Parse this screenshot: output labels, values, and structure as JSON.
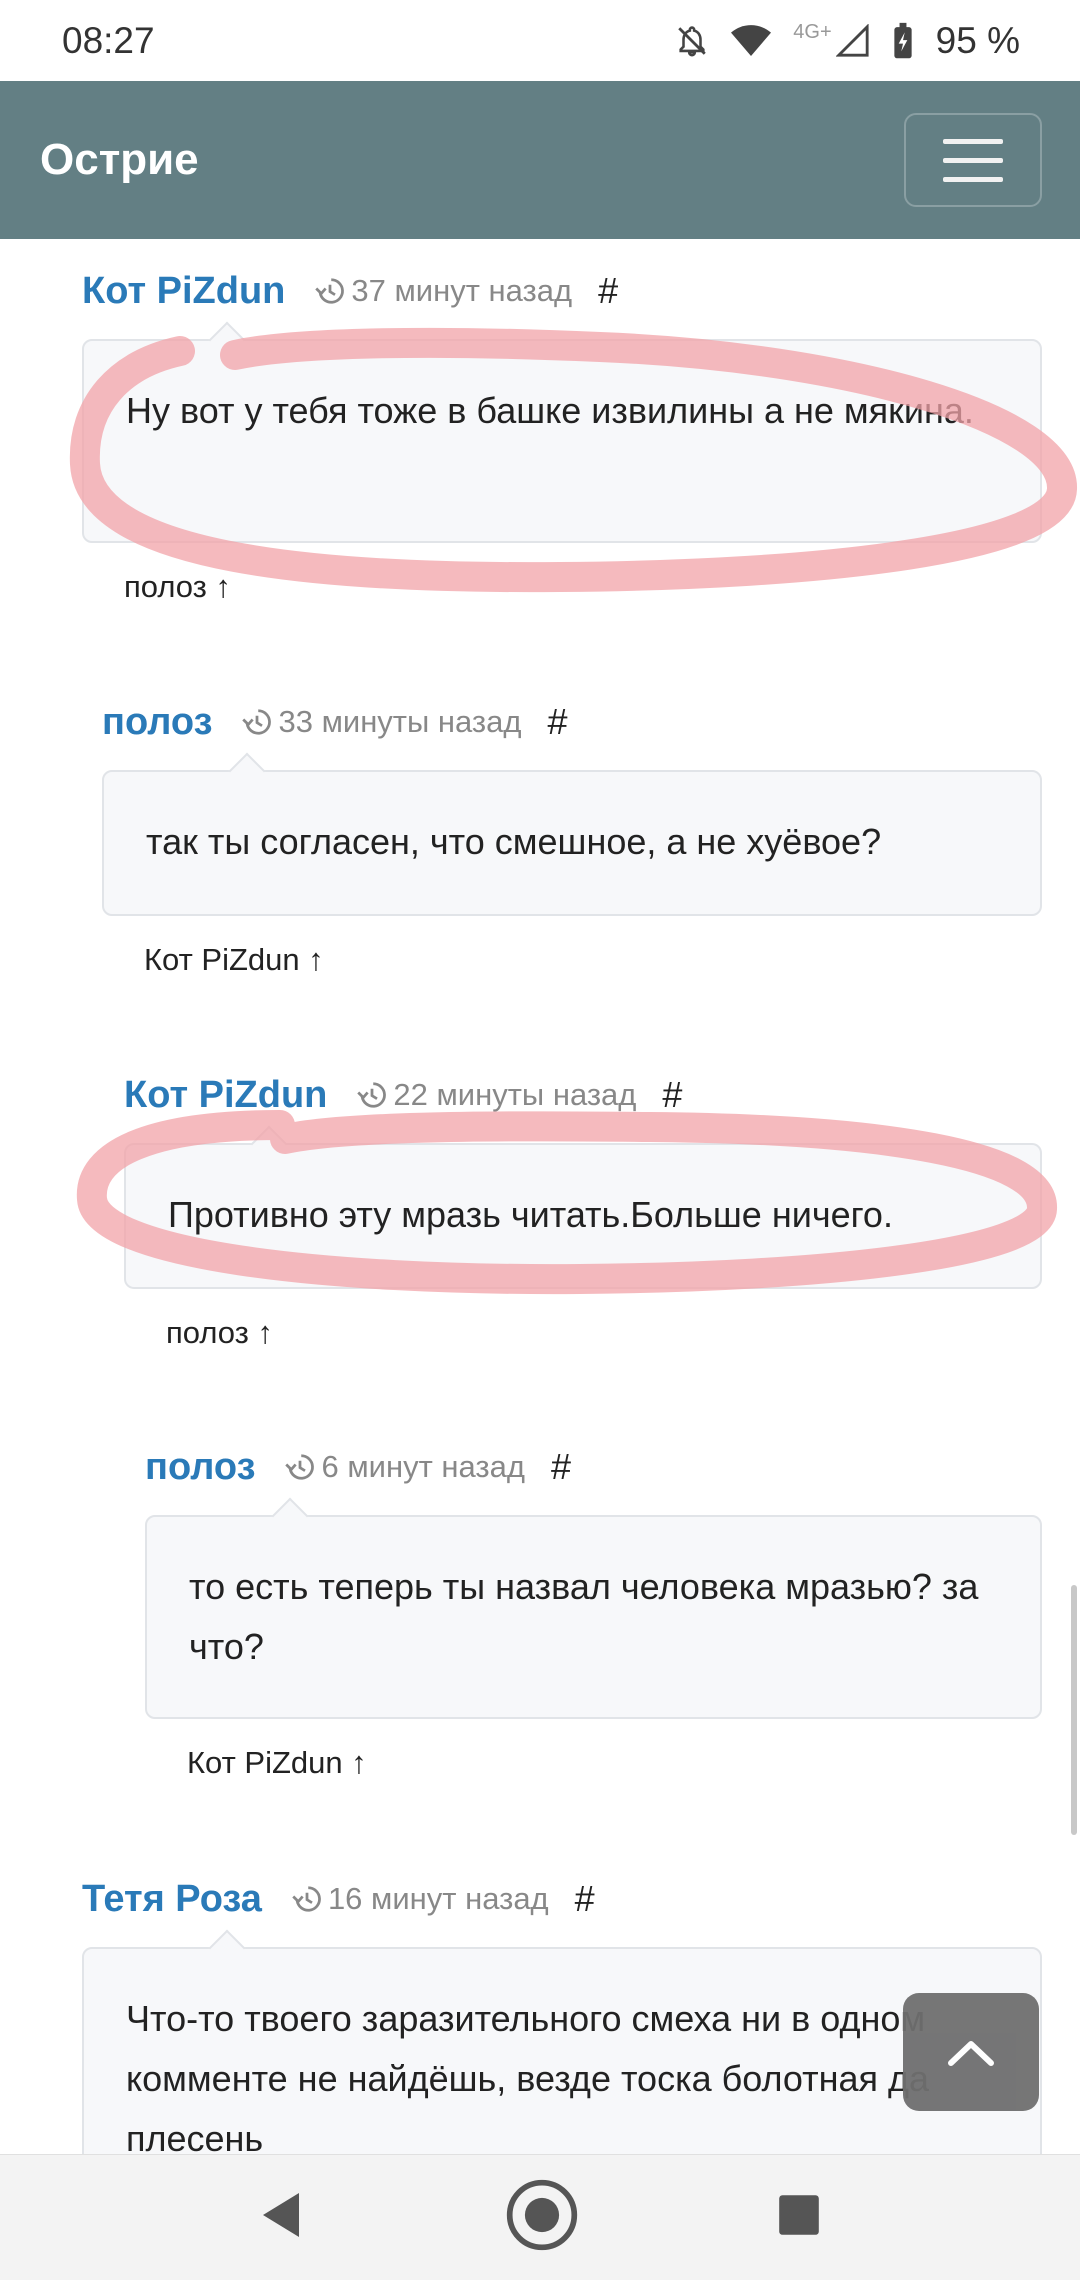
{
  "status": {
    "time": "08:27",
    "battery": "95 %",
    "network": "4G+"
  },
  "navbar": {
    "brand": "Острие"
  },
  "comments": [
    {
      "author": "Кот PiZdun",
      "time": "37 минут назад",
      "anchor": "#",
      "text": "Ну вот у тебя тоже в башке извилины а не мякина.",
      "reply": "полоз ↑"
    },
    {
      "author": "полоз",
      "time": "33 минуты назад",
      "anchor": "#",
      "text": "так ты согласен, что смешное, а не хуёвое?",
      "reply": "Кот PiZdun ↑"
    },
    {
      "author": "Кот PiZdun",
      "time": "22 минуты назад",
      "anchor": "#",
      "text": "Противно эту мразь читать.Больше ничего.",
      "reply": "полоз ↑"
    },
    {
      "author": "полоз",
      "time": "6 минут назад",
      "anchor": "#",
      "text": "то есть теперь ты назвал человека мразью? за что?",
      "reply": "Кот PiZdun ↑"
    },
    {
      "author": "Тетя Роза",
      "time": "16 минут назад",
      "anchor": "#",
      "text": "Что-то твоего заразительного смеха ни в одном комменте не найдёшь, везде тоска болотная да плесень",
      "reply": ""
    }
  ],
  "colors": {
    "navbar": "#637f84",
    "author": "#2a7ab8",
    "annotation": "#f2a3a8"
  }
}
